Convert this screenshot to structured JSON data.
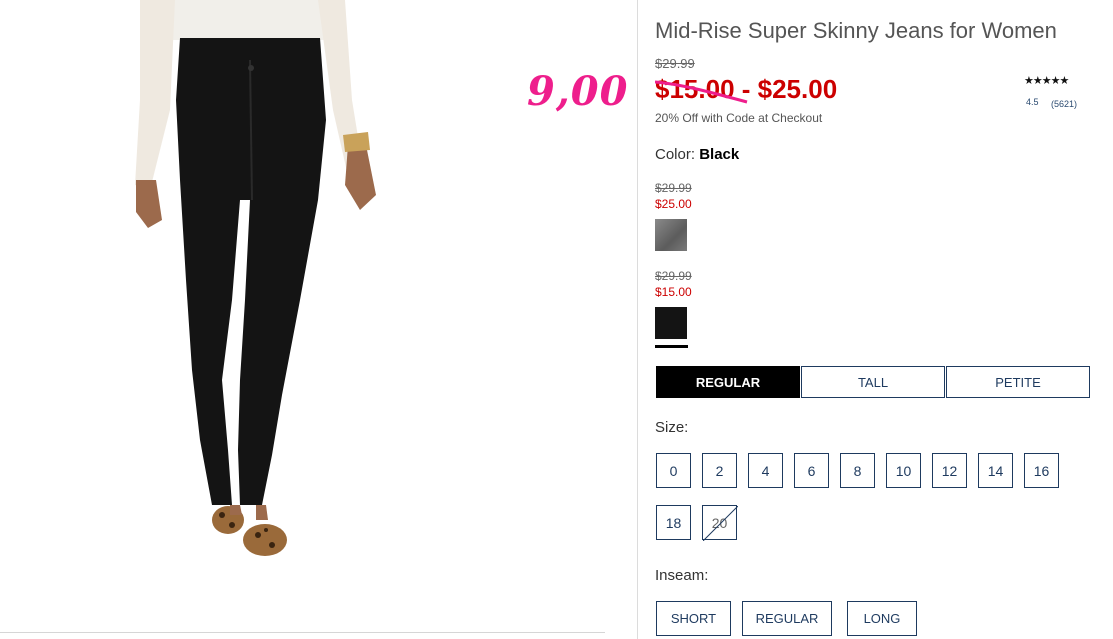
{
  "annotation": {
    "handwritten_price": "9,00"
  },
  "product": {
    "title": "Mid-Rise Super Skinny Jeans for Women",
    "original_price": "$29.99",
    "price_low": "$15.00",
    "price_separator": " - ",
    "price_high": "$25.00",
    "promo": "20% Off with Code at Checkout",
    "rating": {
      "stars": "★★★★★",
      "score": "4.5",
      "count": "(5621)"
    }
  },
  "color": {
    "label": "Color:",
    "selected": "Black",
    "swatches": [
      {
        "name": "gray-swatch",
        "original": "$29.99",
        "sale": "$25.00",
        "color": "#6e6e6e"
      },
      {
        "name": "black-swatch",
        "original": "$29.99",
        "sale": "$15.00",
        "color": "#141414",
        "selected": true
      }
    ]
  },
  "fit": {
    "tabs": [
      {
        "label": "REGULAR",
        "active": true
      },
      {
        "label": "TALL",
        "active": false
      },
      {
        "label": "PETITE",
        "active": false
      }
    ]
  },
  "size": {
    "label": "Size:",
    "options": [
      "0",
      "2",
      "4",
      "6",
      "8",
      "10",
      "12",
      "14",
      "16",
      "18",
      "20"
    ],
    "unavailable": [
      "20"
    ]
  },
  "inseam": {
    "label": "Inseam:",
    "options": [
      "SHORT",
      "REGULAR",
      "LONG"
    ]
  },
  "colors": {
    "sale_red": "#cc0000",
    "navy_outline": "#1e3a5f",
    "scribble_pink": "#ee1e8c"
  }
}
